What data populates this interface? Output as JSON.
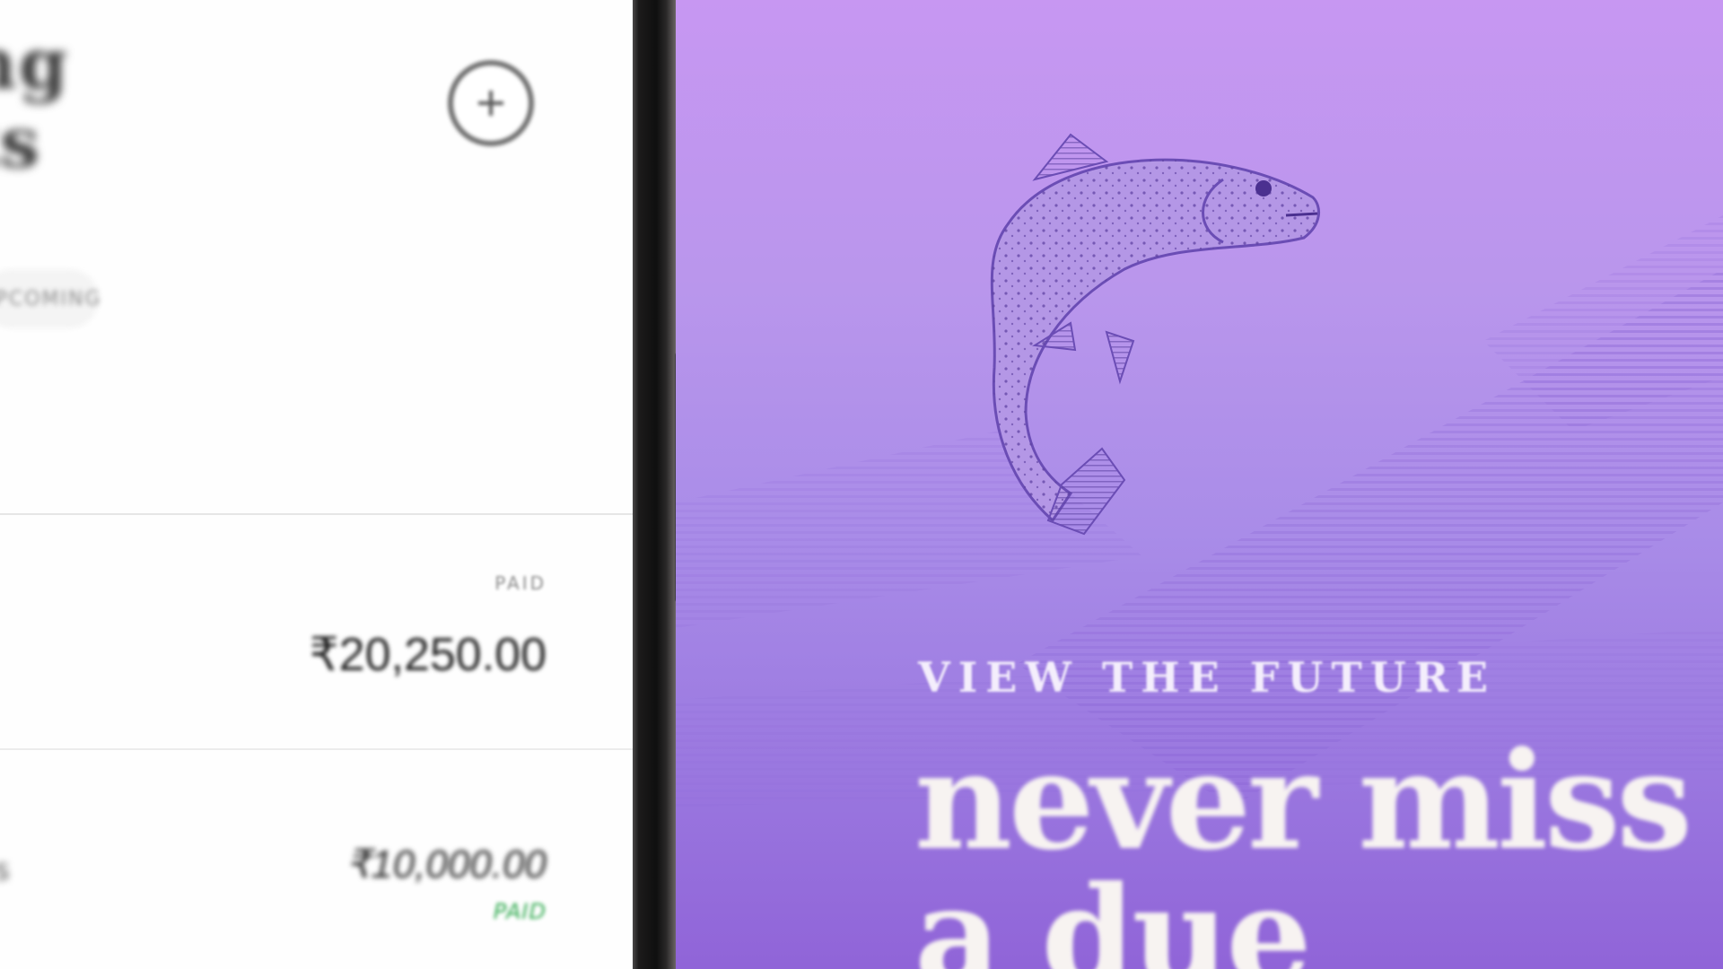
{
  "left_screen": {
    "title_blurred": "ng\nts",
    "add_button_icon": "plus-icon",
    "filter_chip_label": "UPCOMING",
    "rows": [
      {
        "status": "PAID",
        "amount": "₹20,250.00"
      },
      {
        "status": "PAID",
        "amount": "₹10,000.00",
        "status_color": "#2aa84a"
      }
    ],
    "row2_left_fragment": "s"
  },
  "right_screen": {
    "illustration": "fish-illustration",
    "tagline": "VIEW THE FUTURE",
    "headline_line1": "never miss",
    "headline_line2": "a due"
  },
  "colors": {
    "purple_top": "#c797f2",
    "purple_bottom": "#9064d8",
    "paid_green": "#2aa84a"
  }
}
